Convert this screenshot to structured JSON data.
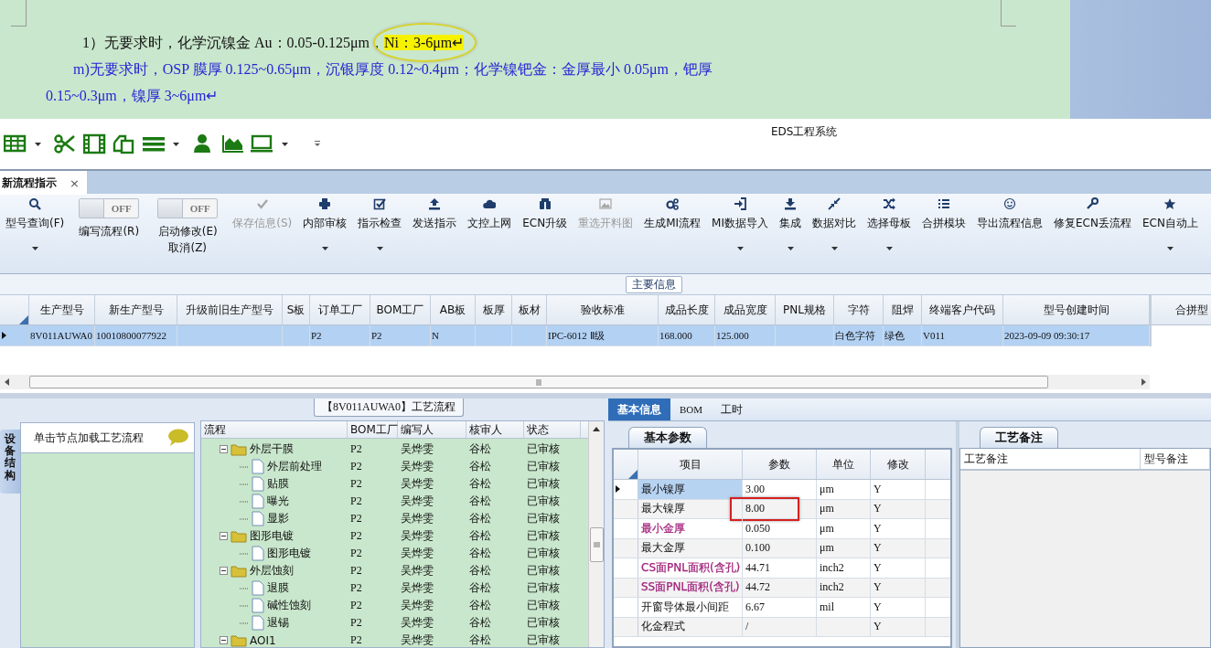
{
  "document": {
    "lines": [
      {
        "kind": "plain",
        "text": "1）无要求时，化学沉镍金 Au：0.05-0.125μm，",
        "highlight": "Ni：3-6μm↵"
      },
      {
        "kind": "item",
        "text": "m)无要求时，OSP 膜厚 0.125~0.65μm，沉银厚度 0.12~0.4μm；化学镍钯金：金厚最小 0.05μm，钯厚"
      },
      {
        "kind": "wrap",
        "text": "0.15~0.3μm，镍厚 3~6μm↵"
      }
    ]
  },
  "quick_toolbar": {
    "title": "EDS工程系统"
  },
  "tabs": [
    {
      "label": "新流程指示",
      "selected": true,
      "close": "×"
    }
  ],
  "ribbon": {
    "buttons": [
      {
        "kind": "button",
        "label": "型号查询(F)",
        "disabled": false,
        "dropdown": true
      },
      {
        "kind": "toggle",
        "label": "编写流程(R)",
        "on": false,
        "state_text": "OFF"
      },
      {
        "kind": "toggle",
        "label": "启动修改(E)\n取消(Z)",
        "on": false,
        "state_text": "OFF"
      },
      {
        "kind": "button",
        "label": "保存信息(S)",
        "disabled": true,
        "dropdown": false
      },
      {
        "kind": "button",
        "label": "内部审核",
        "disabled": false,
        "dropdown": true
      },
      {
        "kind": "button",
        "label": "指示检查",
        "disabled": false,
        "dropdown": true
      },
      {
        "kind": "button",
        "label": "发送指示",
        "disabled": false,
        "dropdown": false
      },
      {
        "kind": "button",
        "label": "文控上网",
        "disabled": false,
        "dropdown": false
      },
      {
        "kind": "button",
        "label": "ECN升级",
        "disabled": false,
        "dropdown": false
      },
      {
        "kind": "button",
        "label": "重选开料图",
        "disabled": true,
        "dropdown": false
      },
      {
        "kind": "button",
        "label": "生成MI流程",
        "disabled": false,
        "dropdown": false
      },
      {
        "kind": "button",
        "label": "MI数据导入",
        "disabled": false,
        "dropdown": true
      },
      {
        "kind": "button",
        "label": "集成",
        "disabled": false,
        "dropdown": true
      },
      {
        "kind": "button",
        "label": "数据对比",
        "disabled": false,
        "dropdown": true
      },
      {
        "kind": "button",
        "label": "选择母板",
        "disabled": false,
        "dropdown": true
      },
      {
        "kind": "button",
        "label": "合拼模块",
        "disabled": false,
        "dropdown": false
      },
      {
        "kind": "button",
        "label": "导出流程信息",
        "disabled": false,
        "dropdown": false
      },
      {
        "kind": "button",
        "label": "修复ECN丢流程",
        "disabled": false,
        "dropdown": false
      },
      {
        "kind": "button",
        "label": "ECN自动上",
        "disabled": false,
        "dropdown": true
      }
    ]
  },
  "main_info": {
    "title": "主要信息",
    "columns": [
      "生产型号",
      "新生产型号",
      "升级前旧生产型号",
      "S板",
      "订单工厂",
      "BOM工厂",
      "AB板",
      "板厚",
      "板材",
      "验收标准",
      "成品长度",
      "成品宽度",
      "PNL规格",
      "字符",
      "阻焊",
      "终端客户代码",
      "型号创建时间"
    ],
    "rows": [
      {
        "selected": true,
        "cells": [
          "8V011AUWA0",
          "10010800077922",
          null,
          null,
          "P2",
          "P2",
          "N",
          null,
          null,
          "IPC-6012 Ⅱ级",
          "168.000",
          "125.000",
          null,
          "白色字符",
          "绿色",
          "V011",
          "2023-09-09 09:30:17"
        ]
      }
    ],
    "side_column": "合拼型"
  },
  "equipment_panel": {
    "tab": "设备结构",
    "hint": "单击节点加载工艺流程"
  },
  "process": {
    "title": "【8V011AUWA0】工艺流程",
    "columns": [
      "流程",
      "BOM工厂",
      "编写人",
      "核审人",
      "状态"
    ],
    "rows": [
      {
        "kind": "folder",
        "label": "外层干膜",
        "expanded": true,
        "bom": "P2",
        "writer": "吴烨雯",
        "reviewer": "谷松",
        "status": "已审核",
        "children": [
          {
            "kind": "step",
            "label": "外层前处理",
            "bom": "P2",
            "writer": "吴烨雯",
            "reviewer": "谷松",
            "status": "已审核"
          },
          {
            "kind": "step",
            "label": "贴膜",
            "bom": "P2",
            "writer": "吴烨雯",
            "reviewer": "谷松",
            "status": "已审核"
          },
          {
            "kind": "step",
            "label": "曝光",
            "bom": "P2",
            "writer": "吴烨雯",
            "reviewer": "谷松",
            "status": "已审核"
          },
          {
            "kind": "step",
            "label": "显影",
            "bom": "P2",
            "writer": "吴烨雯",
            "reviewer": "谷松",
            "status": "已审核"
          }
        ]
      },
      {
        "kind": "folder",
        "label": "图形电镀",
        "expanded": true,
        "bom": "P2",
        "writer": "吴烨雯",
        "reviewer": "谷松",
        "status": "已审核",
        "children": [
          {
            "kind": "step",
            "label": "图形电镀",
            "bom": "P2",
            "writer": "吴烨雯",
            "reviewer": "谷松",
            "status": "已审核"
          }
        ]
      },
      {
        "kind": "folder",
        "label": "外层蚀刻",
        "expanded": true,
        "bom": "P2",
        "writer": "吴烨雯",
        "reviewer": "谷松",
        "status": "已审核",
        "children": [
          {
            "kind": "step",
            "label": "退膜",
            "bom": "P2",
            "writer": "吴烨雯",
            "reviewer": "谷松",
            "status": "已审核"
          },
          {
            "kind": "step",
            "label": "碱性蚀刻",
            "bom": "P2",
            "writer": "吴烨雯",
            "reviewer": "谷松",
            "status": "已审核"
          },
          {
            "kind": "step",
            "label": "退锡",
            "bom": "P2",
            "writer": "吴烨雯",
            "reviewer": "谷松",
            "status": "已审核"
          }
        ]
      },
      {
        "kind": "folder",
        "label": "AOI1",
        "expanded": true,
        "bom": "P2",
        "writer": "吴烨雯",
        "reviewer": "谷松",
        "status": "已审核"
      }
    ]
  },
  "details": {
    "tabs": [
      {
        "label": "基本信息",
        "selected": true
      },
      {
        "label": "BOM",
        "selected": false
      },
      {
        "label": "工时",
        "selected": false
      }
    ],
    "params": {
      "tab": "基本参数",
      "columns": [
        "项目",
        "参数",
        "单位",
        "修改"
      ],
      "rows": [
        {
          "item": "最小镍厚",
          "value": "3.00",
          "unit": "μm",
          "modified": "Y",
          "selected": true,
          "boxed": false
        },
        {
          "item": "最大镍厚",
          "value": "8.00",
          "unit": "μm",
          "modified": "Y",
          "selected": false,
          "boxed": true
        },
        {
          "item": "最小金厚",
          "value": "0.050",
          "unit": "μm",
          "modified": "Y",
          "color": "#a0207a",
          "selected": false,
          "boxed": false
        },
        {
          "item": "最大金厚",
          "value": "0.100",
          "unit": "μm",
          "modified": "Y",
          "selected": false,
          "boxed": false
        },
        {
          "item": "CS面PNL面积(含孔)",
          "value": "44.71",
          "unit": "inch2",
          "modified": "Y",
          "color": "#a0207a",
          "selected": false,
          "boxed": false
        },
        {
          "item": "SS面PNL面积(含孔)",
          "value": "44.72",
          "unit": "inch2",
          "modified": "Y",
          "color": "#a0207a",
          "selected": false,
          "boxed": false
        },
        {
          "item": "开窗导体最小间距",
          "value": "6.67",
          "unit": "mil",
          "modified": "Y",
          "selected": false,
          "boxed": false
        },
        {
          "item": "化金程式",
          "value": "/",
          "unit": null,
          "modified": "Y",
          "selected": false,
          "boxed": false
        }
      ]
    },
    "notes": {
      "tab": "工艺备注",
      "columns": [
        "工艺备注",
        "型号备注"
      ]
    }
  }
}
